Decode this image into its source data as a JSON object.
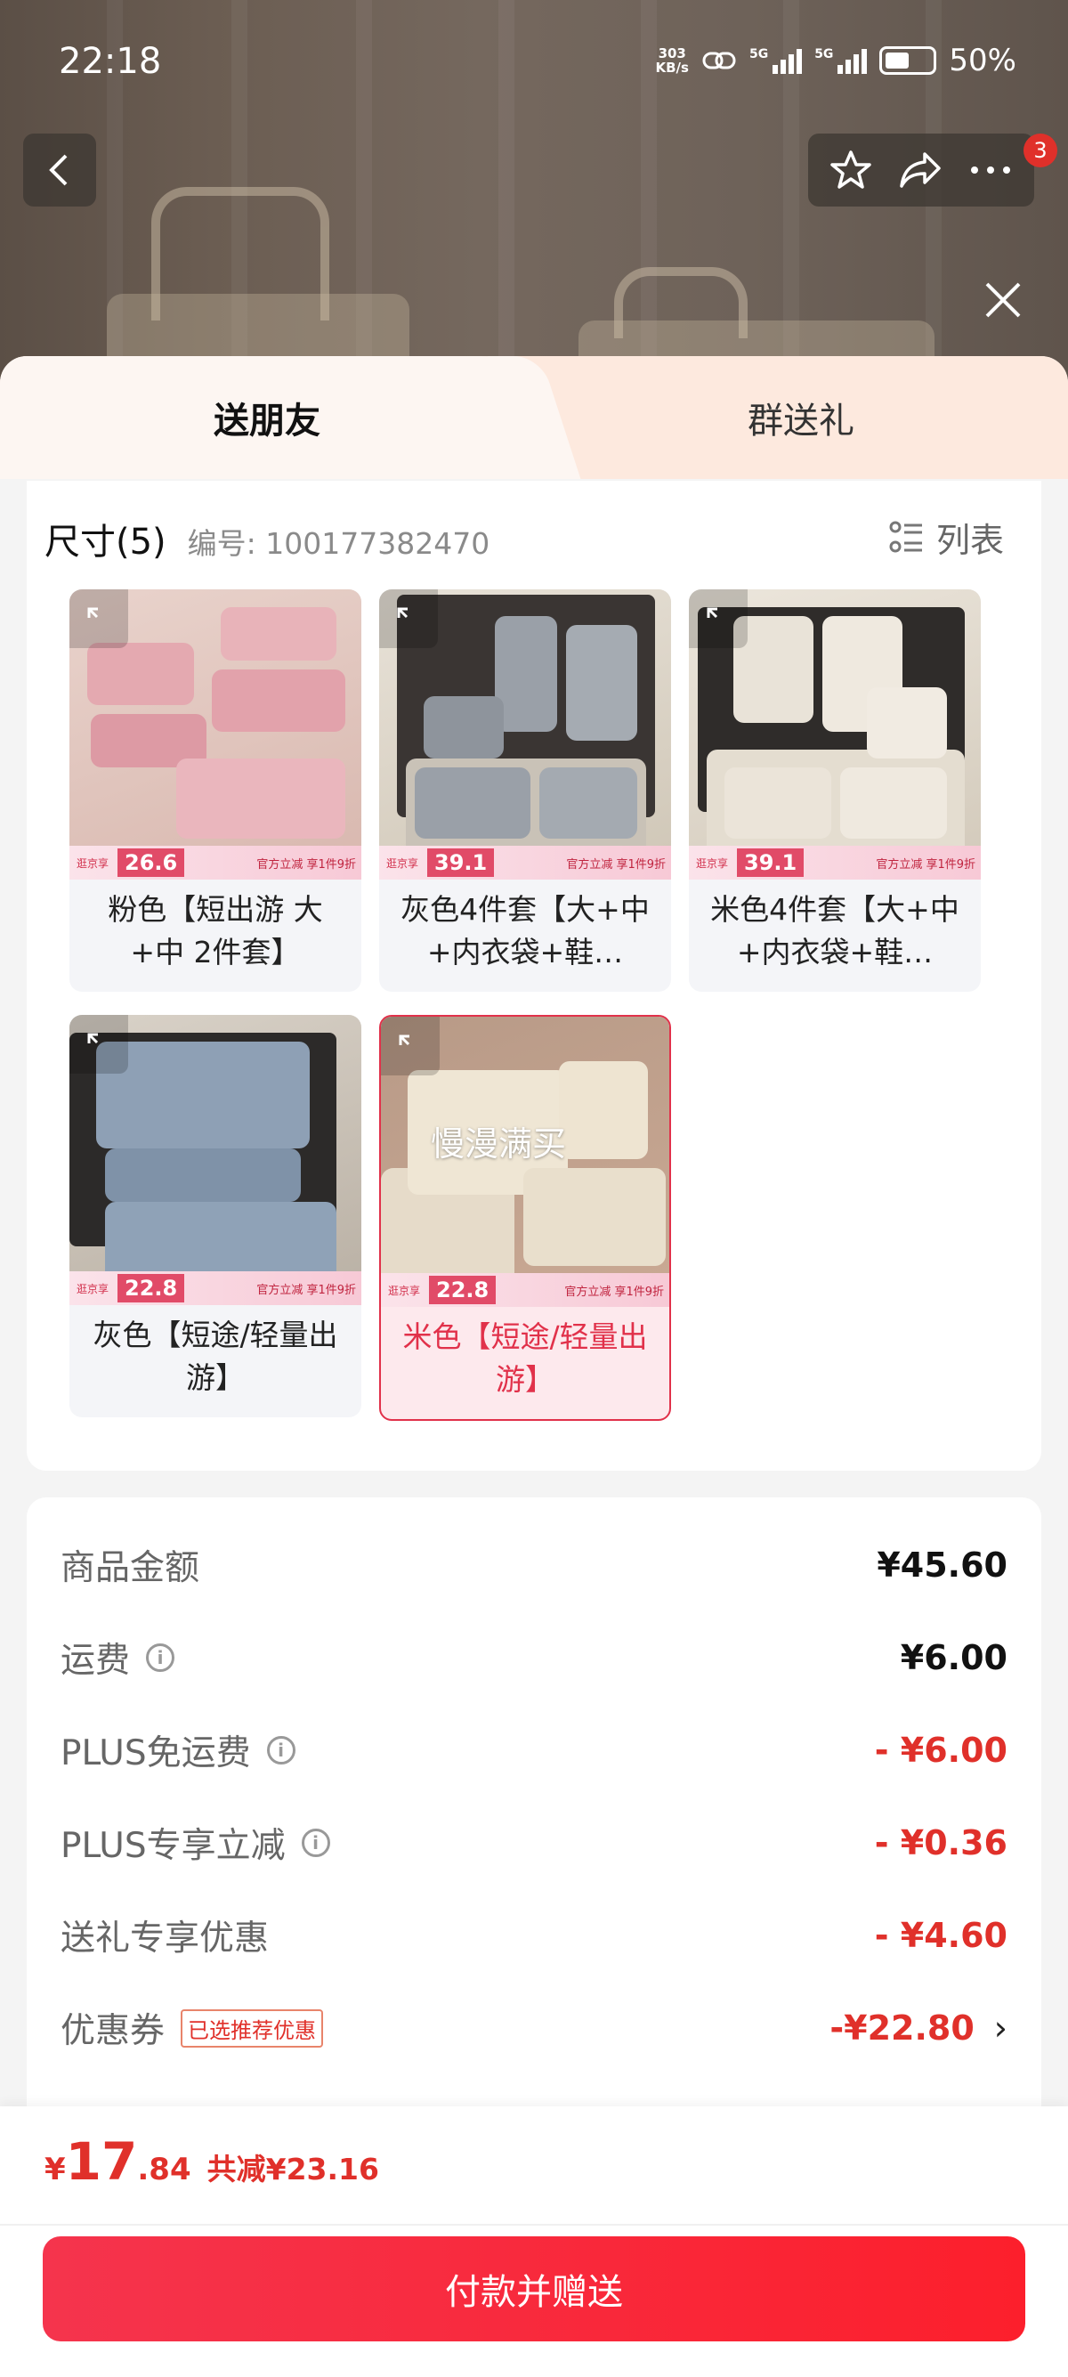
{
  "status_bar": {
    "time": "22:18",
    "net_speed_value": "303",
    "net_speed_unit": "KB/s",
    "signal_1": "5G",
    "signal_2": "5G",
    "battery": "50%"
  },
  "top_nav": {
    "back_icon": "chevron-left-icon",
    "favorite_icon": "star-icon",
    "share_icon": "share-icon",
    "more_icon": "more-icon",
    "badge_count": "3",
    "close_icon": "close-icon"
  },
  "tabs": [
    {
      "label": "送朋友",
      "active": true
    },
    {
      "label": "群送礼",
      "active": false
    }
  ],
  "spec": {
    "title": "尺寸(5)",
    "code": "编号: 100177382470",
    "view_toggle": "列表",
    "items": [
      {
        "name": "粉色【短出游 大+中 2件套】",
        "promo_price": "26.6",
        "selected": false
      },
      {
        "name": "灰色4件套【大+中+内衣袋+鞋…",
        "promo_price": "39.1",
        "selected": false
      },
      {
        "name": "米色4件套【大+中+内衣袋+鞋…",
        "promo_price": "39.1",
        "selected": false
      },
      {
        "name": "灰色【短途/轻量出游】",
        "promo_price": "22.8",
        "selected": false
      },
      {
        "name": "米色【短途/轻量出游】",
        "promo_price": "22.8",
        "selected": true,
        "overlay": "慢漫满买"
      }
    ],
    "promo_brand": "逛京享",
    "promo_label": "官方立减 享1件9折"
  },
  "fees": {
    "goods_amount_label": "商品金额",
    "goods_amount": "¥45.60",
    "shipping_label": "运费",
    "shipping": "¥6.00",
    "plus_free_shipping_label": "PLUS免运费",
    "plus_free_shipping": "- ¥6.00",
    "plus_discount_label": "PLUS专享立减",
    "plus_discount": "- ¥0.36",
    "gift_discount_label": "送礼专享优惠",
    "gift_discount": "- ¥4.60",
    "coupon_label": "优惠券",
    "coupon_tag": "已选推荐优惠",
    "coupon": "-¥22.80"
  },
  "checkout": {
    "currency": "¥",
    "total_int": "17",
    "total_dec": ".84",
    "saved": "共减¥23.16",
    "pay_button": "付款并赠送"
  },
  "colors": {
    "accent_red": "#e0302a",
    "button_red": "#f5344d",
    "tab_bg": "#fde9de"
  }
}
